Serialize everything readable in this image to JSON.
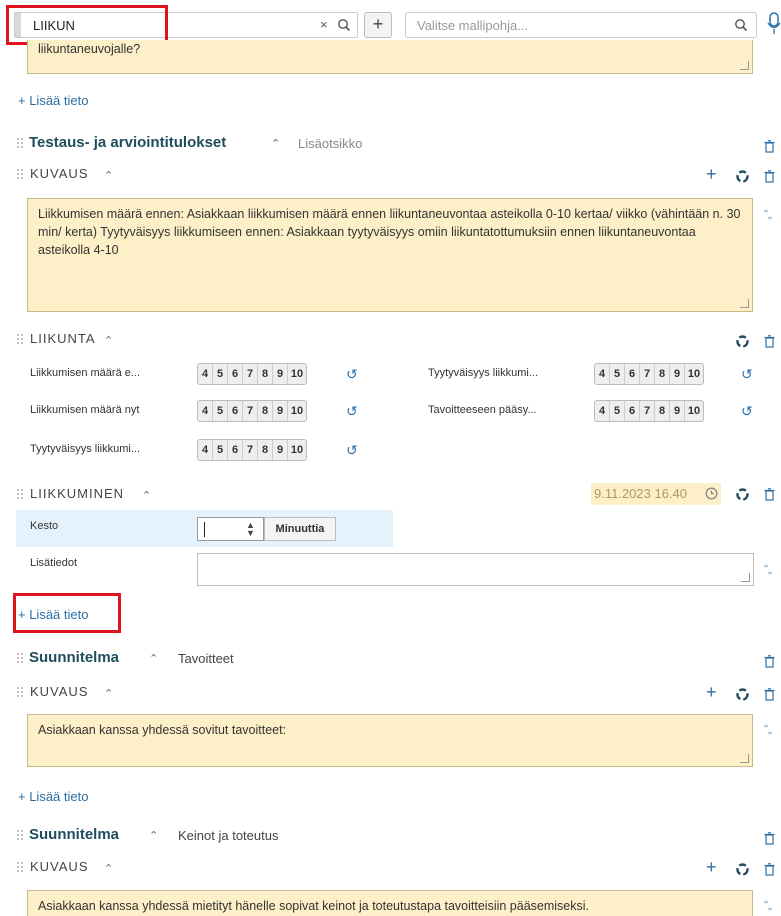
{
  "topbar": {
    "search_value": "LIIKUN",
    "clear_symbol": "×",
    "add_symbol": "+",
    "template_placeholder": "Valitse mallipohja..."
  },
  "top_area_text": "liikuntaneuvojalle?",
  "add_info_label": "+ Lisää tieto",
  "quote_symbol": "“„",
  "section1": {
    "title": "Testaus- ja arviointitulokset",
    "subtitle": "Lisäotsikko",
    "kuvaus_header": "KUVAUS",
    "kuvaus_text": "Liikkumisen määrä ennen: Asiakkaan liikkumisen määrä ennen liikuntaneuvontaa asteikolla 0-10 kertaa/ viikko (vähintään n. 30 min/ kerta)    Tyytyväisyys liikkumiseen ennen: Asiakkaan tyytyväisyys omiin liikuntatottumuksiin ennen liikuntaneuvontaa asteikolla 4-10"
  },
  "liikunta": {
    "header": "LIIKUNTA",
    "scale_values": [
      "4",
      "5",
      "6",
      "7",
      "8",
      "9",
      "10"
    ],
    "items": [
      {
        "label": "Liikkumisen määrä e..."
      },
      {
        "label": "Tyytyväisyys liikkumi..."
      },
      {
        "label": "Liikkumisen määrä nyt"
      },
      {
        "label": "Tavoitteeseen pääsy..."
      },
      {
        "label": "Tyytyväisyys liikkumi..."
      }
    ]
  },
  "liikkuminen": {
    "header": "LIIKKUMINEN",
    "date": "9.11.2023  16.40",
    "kesto_label": "Kesto",
    "kesto_unit": "Minuuttia",
    "lisatiedot_label": "Lisätiedot"
  },
  "section2": {
    "title": "Suunnitelma",
    "subtitle": "Tavoitteet",
    "kuvaus_header": "KUVAUS",
    "kuvaus_text": "Asiakkaan kanssa yhdessä sovitut tavoitteet:"
  },
  "section3": {
    "title": "Suunnitelma",
    "subtitle": "Keinot ja toteutus",
    "kuvaus_header": "KUVAUS",
    "kuvaus_text": "Asiakkaan kanssa yhdessä mietityt hänelle sopivat keinot ja toteutustapa tavoitteisiin pääsemiseksi."
  },
  "colors": {
    "highlight_red": "#e0141e",
    "note_yellow": "#fdf0c8",
    "link_blue": "#2b6ea6",
    "title_teal": "#1f4d5e",
    "kesto_row_blue": "#e5f2fb"
  }
}
